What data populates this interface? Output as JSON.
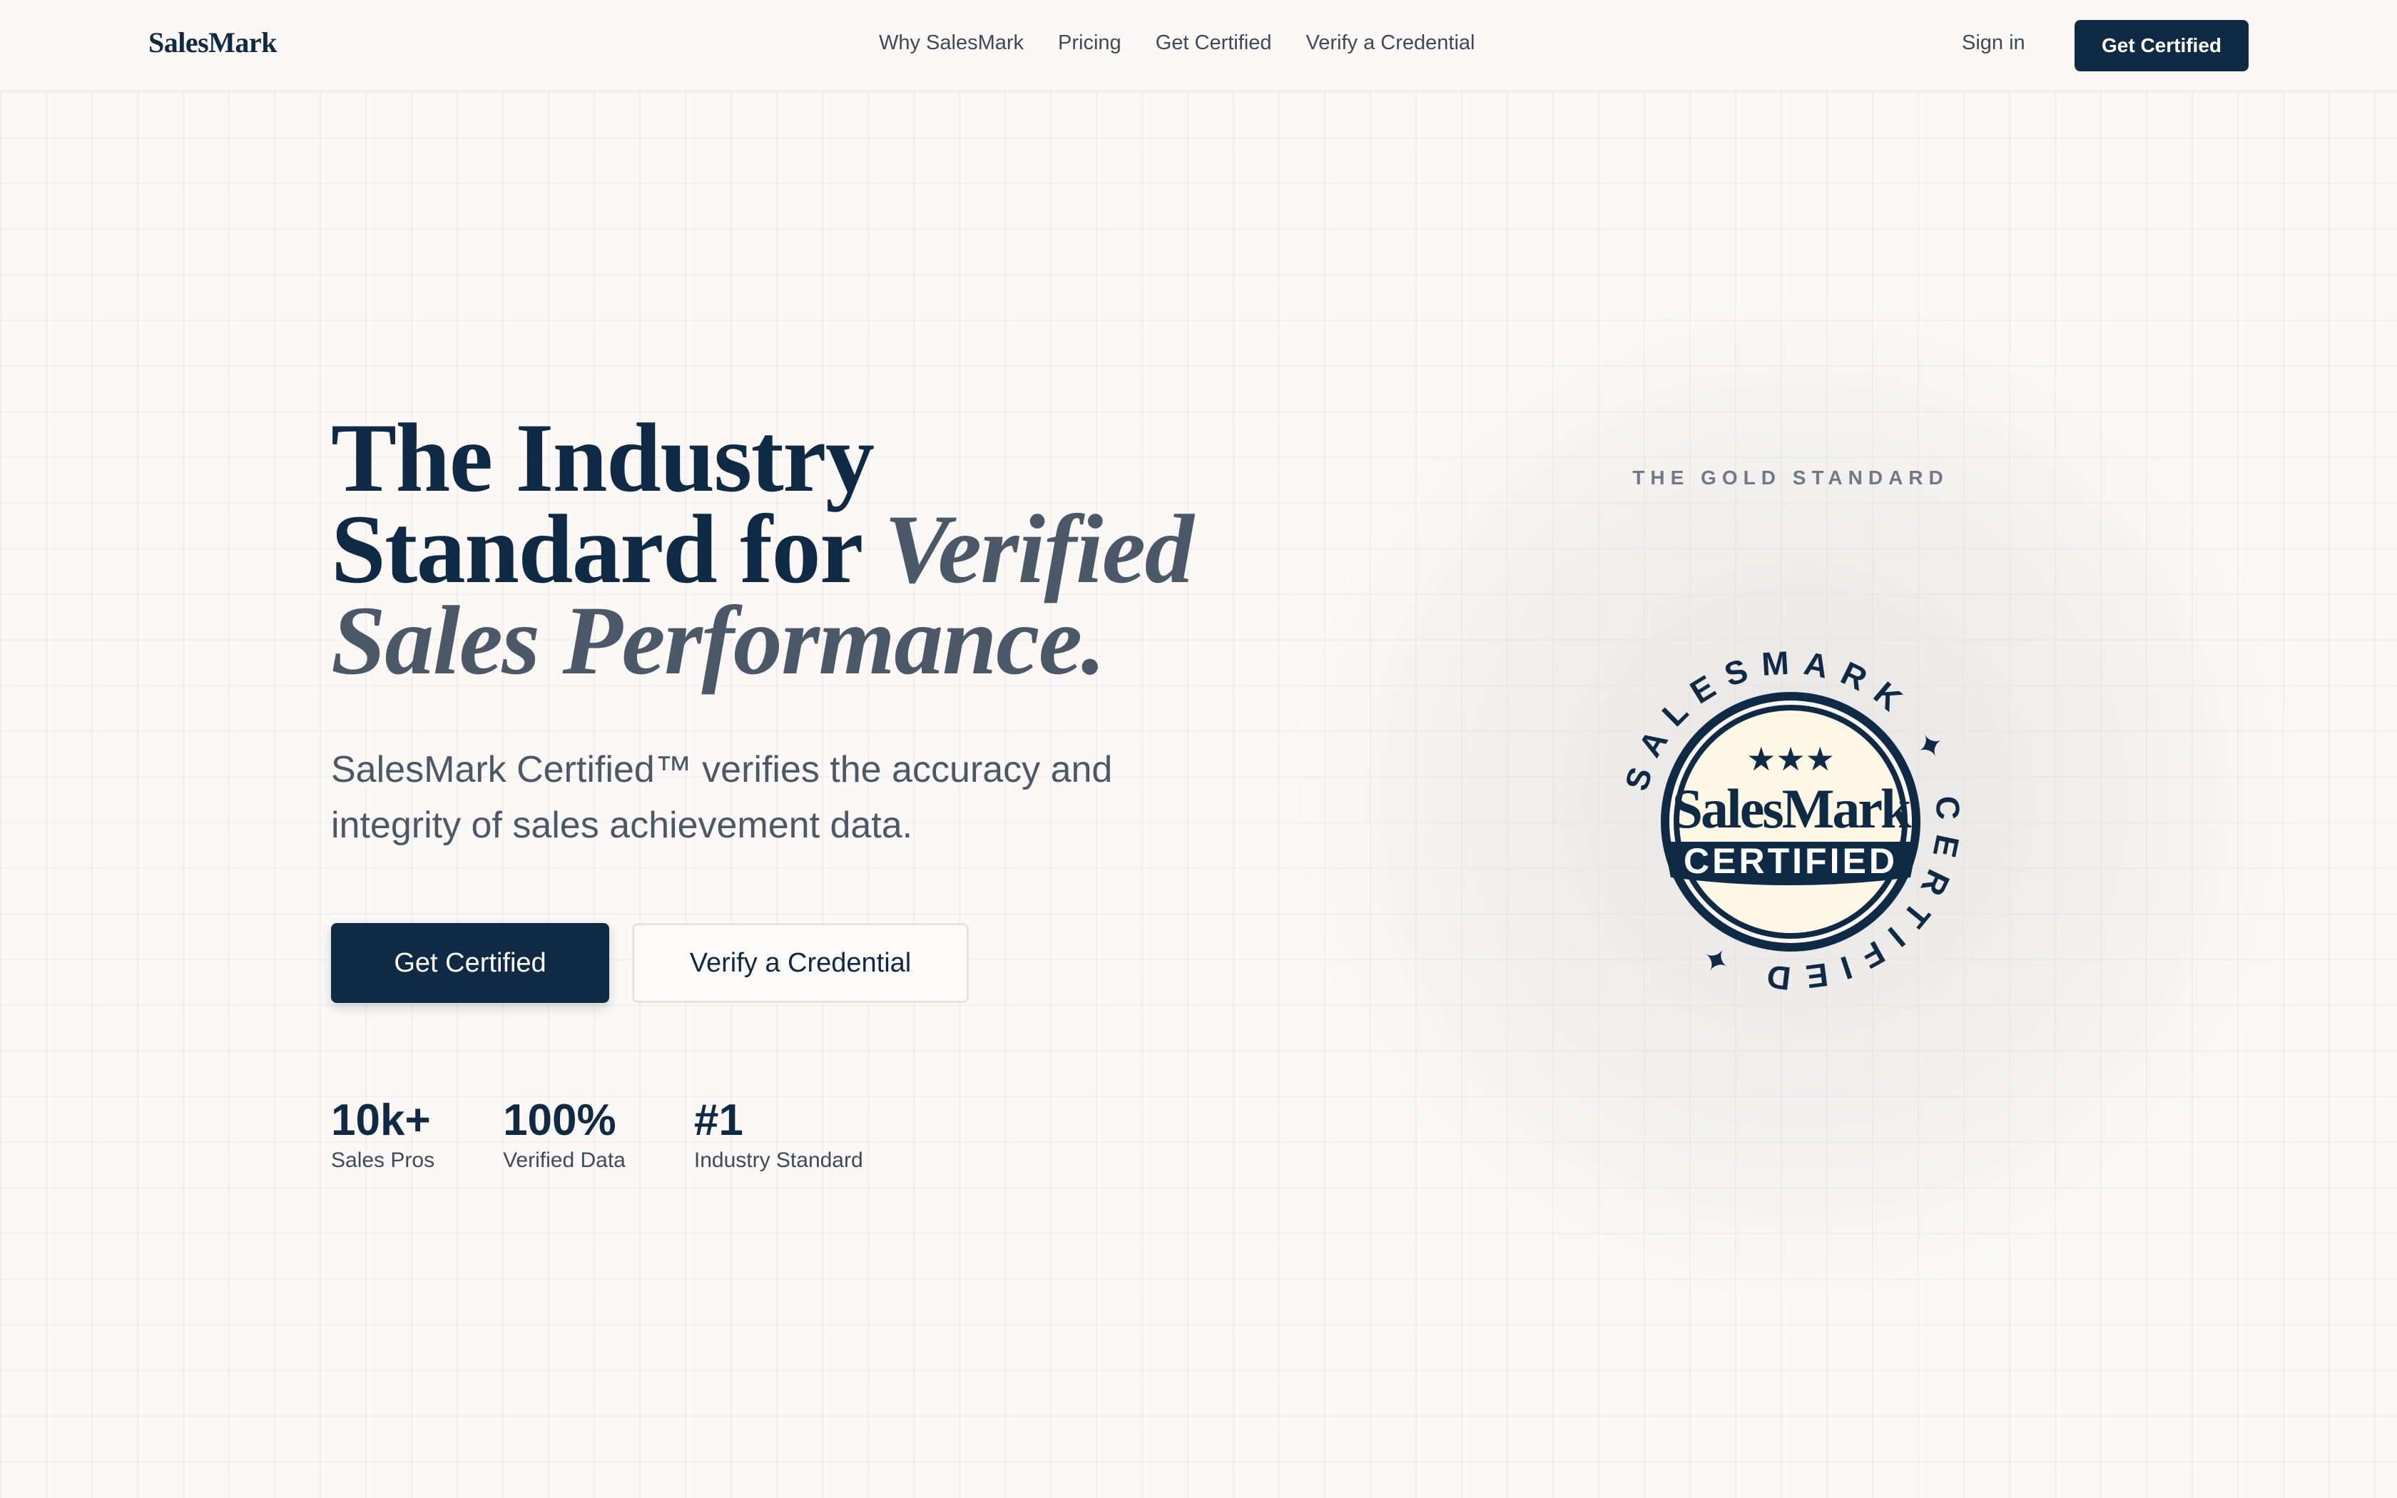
{
  "nav": {
    "brand": "SalesMark",
    "links": [
      "Why SalesMark",
      "Pricing",
      "Get Certified",
      "Verify a Credential"
    ],
    "signin": "Sign in",
    "cta": "Get Certified"
  },
  "hero": {
    "title_line1": "The Industry",
    "title_line2_plain": "Standard for ",
    "title_line2_em": "Verified",
    "title_line3_em": "Sales Performance.",
    "subtitle": "SalesMark Certified™ verifies the accuracy and integrity of sales achievement data.",
    "primary_button": "Get Certified",
    "secondary_button": "Verify a Credential",
    "stats": [
      {
        "value": "10k+",
        "label": "Sales Pros"
      },
      {
        "value": "100%",
        "label": "Verified Data"
      },
      {
        "value": "#1",
        "label": "Industry Standard"
      }
    ]
  },
  "badge": {
    "eyebrow": "THE GOLD STANDARD",
    "ring_text": "SALESMARK  ✦  CERTIFIED  ✦",
    "wordmark": "SalesMark",
    "banner": "CERTIFIED",
    "stars": "★★★"
  },
  "colors": {
    "navy": "#0f2a44",
    "slate": "#4a5868",
    "background": "#fbf8f5",
    "badge_fill": "#fdf8e6"
  }
}
